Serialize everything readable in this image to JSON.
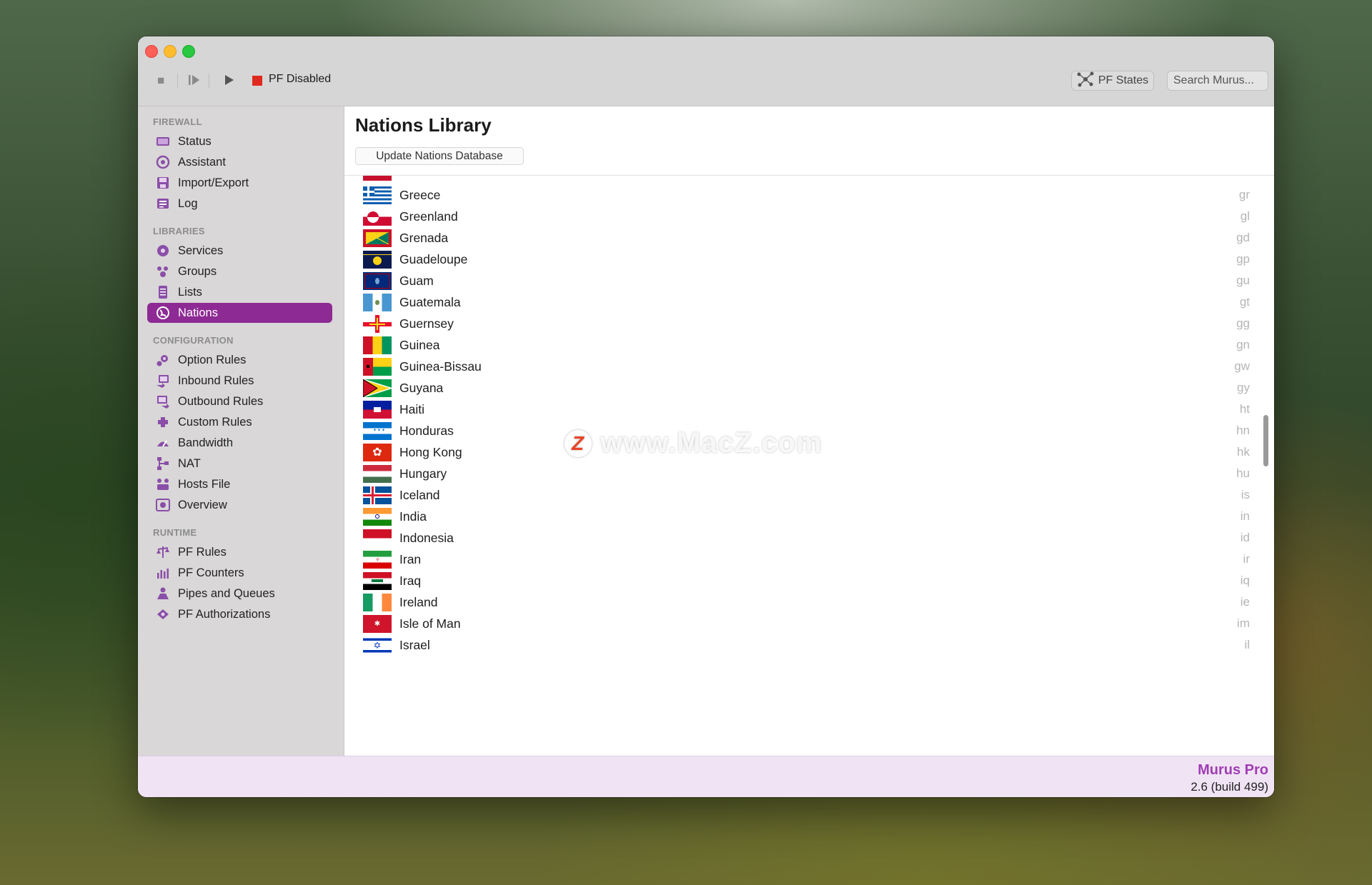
{
  "toolbar": {
    "status_label": "PF Disabled",
    "pf_states_label": "PF States",
    "search_placeholder": "Search Murus..."
  },
  "sidebar": {
    "sections": [
      {
        "title": "FIREWALL",
        "items": [
          {
            "label": "Status",
            "icon": "status-icon"
          },
          {
            "label": "Assistant",
            "icon": "assistant-icon"
          },
          {
            "label": "Import/Export",
            "icon": "import-export-icon"
          },
          {
            "label": "Log",
            "icon": "log-icon"
          }
        ]
      },
      {
        "title": "LIBRARIES",
        "items": [
          {
            "label": "Services",
            "icon": "services-icon"
          },
          {
            "label": "Groups",
            "icon": "groups-icon"
          },
          {
            "label": "Lists",
            "icon": "lists-icon"
          },
          {
            "label": "Nations",
            "icon": "nations-icon",
            "selected": true
          }
        ]
      },
      {
        "title": "CONFIGURATION",
        "items": [
          {
            "label": "Option Rules",
            "icon": "option-rules-icon"
          },
          {
            "label": "Inbound Rules",
            "icon": "inbound-rules-icon"
          },
          {
            "label": "Outbound Rules",
            "icon": "outbound-rules-icon"
          },
          {
            "label": "Custom Rules",
            "icon": "custom-rules-icon"
          },
          {
            "label": "Bandwidth",
            "icon": "bandwidth-icon"
          },
          {
            "label": "NAT",
            "icon": "nat-icon"
          },
          {
            "label": "Hosts File",
            "icon": "hosts-file-icon"
          },
          {
            "label": "Overview",
            "icon": "overview-icon"
          }
        ]
      },
      {
        "title": "RUNTIME",
        "items": [
          {
            "label": "PF Rules",
            "icon": "pf-rules-icon"
          },
          {
            "label": "PF Counters",
            "icon": "pf-counters-icon"
          },
          {
            "label": "Pipes and Queues",
            "icon": "pipes-queues-icon"
          },
          {
            "label": "PF Authorizations",
            "icon": "pf-authorizations-icon"
          }
        ]
      }
    ]
  },
  "main": {
    "title": "Nations Library",
    "update_button": "Update Nations Database",
    "nations": [
      {
        "name": "Greece",
        "code": "gr"
      },
      {
        "name": "Greenland",
        "code": "gl"
      },
      {
        "name": "Grenada",
        "code": "gd"
      },
      {
        "name": "Guadeloupe",
        "code": "gp"
      },
      {
        "name": "Guam",
        "code": "gu"
      },
      {
        "name": "Guatemala",
        "code": "gt"
      },
      {
        "name": "Guernsey",
        "code": "gg"
      },
      {
        "name": "Guinea",
        "code": "gn"
      },
      {
        "name": "Guinea-Bissau",
        "code": "gw"
      },
      {
        "name": "Guyana",
        "code": "gy"
      },
      {
        "name": "Haiti",
        "code": "ht"
      },
      {
        "name": "Honduras",
        "code": "hn"
      },
      {
        "name": "Hong Kong",
        "code": "hk"
      },
      {
        "name": "Hungary",
        "code": "hu"
      },
      {
        "name": "Iceland",
        "code": "is"
      },
      {
        "name": "India",
        "code": "in"
      },
      {
        "name": "Indonesia",
        "code": "id"
      },
      {
        "name": "Iran",
        "code": "ir"
      },
      {
        "name": "Iraq",
        "code": "iq"
      },
      {
        "name": "Ireland",
        "code": "ie"
      },
      {
        "name": "Isle of Man",
        "code": "im"
      },
      {
        "name": "Israel",
        "code": "il"
      }
    ]
  },
  "footer": {
    "product": "Murus Pro",
    "version": "2.6 (build 499)"
  },
  "watermark": {
    "text": "www.MacZ.com",
    "logo_letter": "Z"
  },
  "colors": {
    "accent": "#8d2a94",
    "status_red": "#e02a20",
    "product_purple": "#a03cb4"
  }
}
